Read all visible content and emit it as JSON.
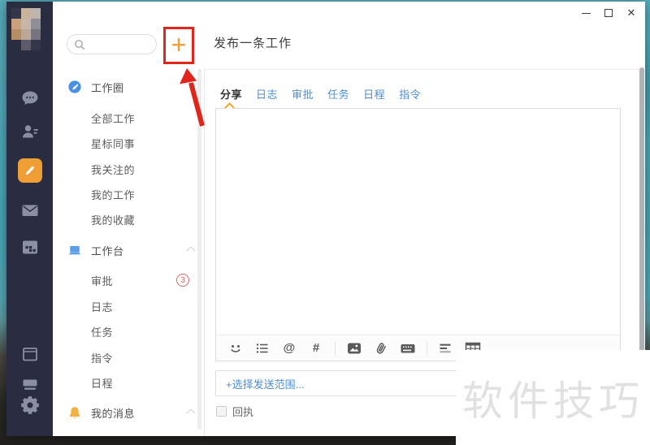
{
  "colors": {
    "accent_orange": "#ee9e35",
    "sidebar_bg": "#2a2c41",
    "link_blue": "#4a8fd4",
    "badge_red": "#e06666",
    "annotation_red": "#e1251b",
    "watermark_gray": "#e1e1e1"
  },
  "window_controls": {
    "minimize_glyph": "—",
    "close_glyph": "✕"
  },
  "nav": {
    "search_value": "",
    "add_button_glyph": "+",
    "sections": [
      {
        "label": "工作圈",
        "items": [
          {
            "label": "全部工作"
          },
          {
            "label": "星标同事"
          },
          {
            "label": "我关注的"
          },
          {
            "label": "我的工作"
          },
          {
            "label": "我的收藏"
          }
        ]
      },
      {
        "label": "工作台",
        "items": [
          {
            "label": "审批",
            "badge": "3"
          },
          {
            "label": "日志"
          },
          {
            "label": "任务"
          },
          {
            "label": "指令"
          },
          {
            "label": "日程"
          }
        ]
      },
      {
        "label": "我的消息",
        "items": []
      }
    ]
  },
  "main": {
    "title": "发布一条工作",
    "tabs": [
      {
        "label": "分享"
      },
      {
        "label": "日志"
      },
      {
        "label": "审批"
      },
      {
        "label": "任务"
      },
      {
        "label": "日程"
      },
      {
        "label": "指令"
      }
    ],
    "active_tab": "分享",
    "editor_value": "",
    "toolbar": {
      "at_glyph": "@",
      "hash_glyph": "#"
    },
    "scope_placeholder": "+选择发送范围...",
    "receipt_label": "回执"
  },
  "watermark_text": "软件技巧"
}
